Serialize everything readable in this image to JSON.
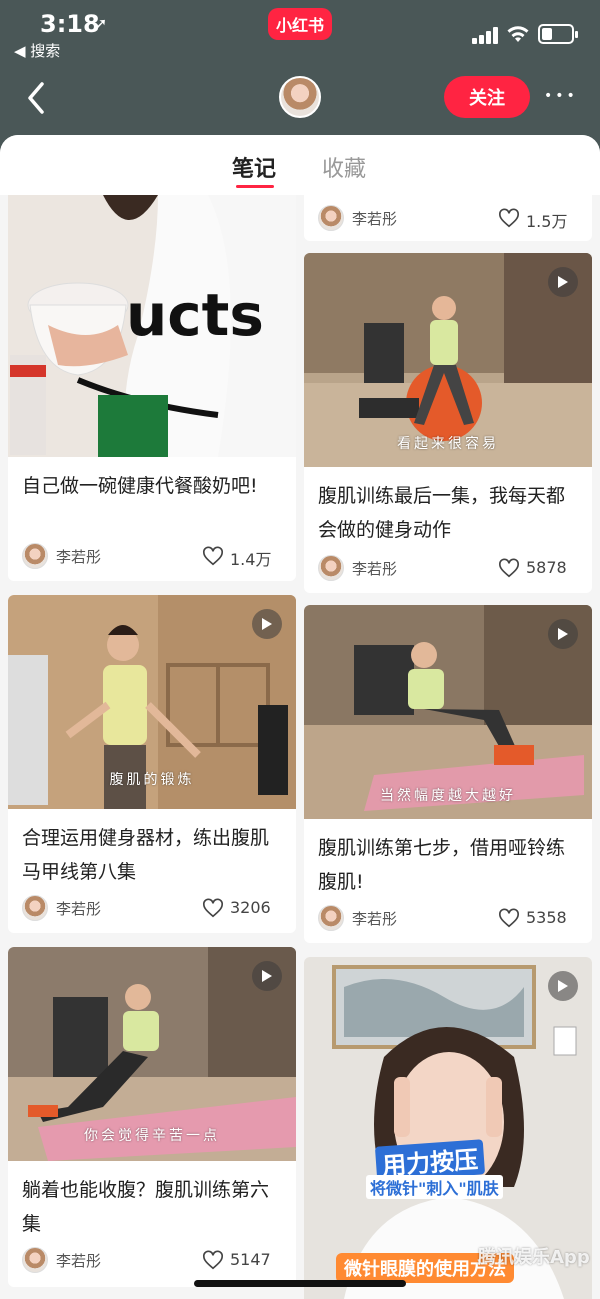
{
  "status_bar": {
    "time": "3:18",
    "back_label": "◀ 搜索",
    "app_badge": "小红书"
  },
  "nav": {
    "follow_label": "关注",
    "more_label": "•••"
  },
  "tabs": [
    {
      "label": "笔记",
      "active": true
    },
    {
      "label": "收藏",
      "active": false
    }
  ],
  "top_partial": {
    "author": "李若彤",
    "likes": "1.5万"
  },
  "notes": [
    {
      "title": "自己做一碗健康代餐酸奶吧!",
      "author": "李若彤",
      "likes": "1.4万",
      "video": false,
      "caption": ""
    },
    {
      "title": "腹肌训练最后一集，我每天都会做的健身动作",
      "author": "李若彤",
      "likes": "5878",
      "video": true,
      "caption": "看起来很容易"
    },
    {
      "title": "合理运用健身器材，练出腹肌马甲线第八集",
      "author": "李若彤",
      "likes": "3206",
      "video": true,
      "caption": "腹肌的锻炼"
    },
    {
      "title": "腹肌训练第七步，借用哑铃练腹肌!",
      "author": "李若彤",
      "likes": "5358",
      "video": true,
      "caption": "当然幅度越大越好"
    },
    {
      "title": "躺着也能收腹？腹肌训练第六集",
      "author": "李若彤",
      "likes": "5147",
      "video": true,
      "caption": "你会觉得辛苦一点"
    },
    {
      "title": "",
      "author": "",
      "likes": "",
      "video": true,
      "caption": "微针眼膜的使用方法",
      "overlay_1": "用力按压",
      "overlay_2": "将微针\"刺入\"肌肤"
    }
  ],
  "watermark": "腾讯娱乐App",
  "colors": {
    "brand_red": "#ff2442",
    "header_bg": "#4a5757",
    "feed_bg": "#f5f5f5"
  }
}
